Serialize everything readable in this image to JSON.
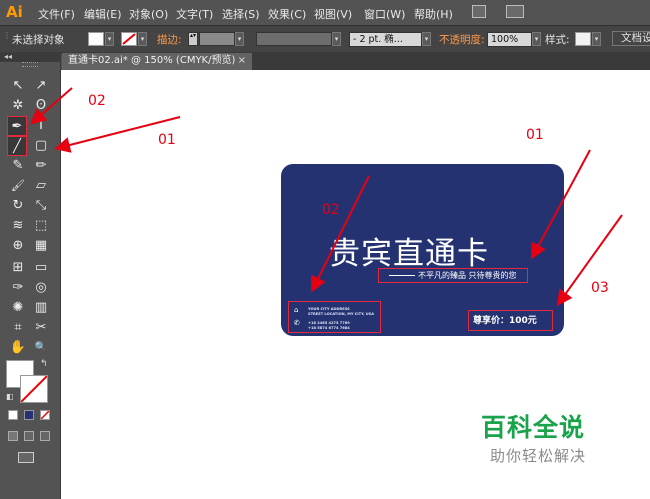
{
  "app": {
    "logo": "Ai"
  },
  "menu": [
    "文件(F)",
    "编辑(E)",
    "对象(O)",
    "文字(T)",
    "选择(S)",
    "效果(C)",
    "视图(V)",
    "窗口(W)",
    "帮助(H)"
  ],
  "control_bar": {
    "selection_status": "未选择对象",
    "stroke_label": "描边:",
    "stroke_profile": "- 2 pt. 椭...",
    "opacity_label": "不透明度:",
    "opacity_value": "100%",
    "style_label": "样式:",
    "doc_setup": "文档设"
  },
  "document_tab": {
    "title": "直通卡02.ai* @ 150% (CMYK/预览)",
    "close": "×"
  },
  "toolbox": {
    "header": "◂◂",
    "tools": [
      {
        "name": "selection-tool",
        "glyph": "↖"
      },
      {
        "name": "direct-selection-tool",
        "glyph": "↗"
      },
      {
        "name": "magic-wand-tool",
        "glyph": "✲"
      },
      {
        "name": "lasso-tool",
        "glyph": "ʘ"
      },
      {
        "name": "pen-tool",
        "glyph": "✒"
      },
      {
        "name": "type-tool",
        "glyph": "T"
      },
      {
        "name": "line-segment-tool",
        "glyph": "╱"
      },
      {
        "name": "rounded-rectangle-tool",
        "glyph": "▢"
      },
      {
        "name": "paintbrush-tool",
        "glyph": "✎"
      },
      {
        "name": "pencil-tool",
        "glyph": "✏"
      },
      {
        "name": "blob-brush-tool",
        "glyph": "🖌"
      },
      {
        "name": "eraser-tool",
        "glyph": "▱"
      },
      {
        "name": "rotate-tool",
        "glyph": "↻"
      },
      {
        "name": "scale-tool",
        "glyph": "⤡"
      },
      {
        "name": "width-tool",
        "glyph": "≋"
      },
      {
        "name": "free-transform-tool",
        "glyph": "⬚"
      },
      {
        "name": "shape-builder-tool",
        "glyph": "⊕"
      },
      {
        "name": "perspective-grid-tool",
        "glyph": "▦"
      },
      {
        "name": "mesh-tool",
        "glyph": "⊞"
      },
      {
        "name": "gradient-tool",
        "glyph": "▭"
      },
      {
        "name": "eyedropper-tool",
        "glyph": "✑"
      },
      {
        "name": "blend-tool",
        "glyph": "◎"
      },
      {
        "name": "symbol-sprayer-tool",
        "glyph": "✺"
      },
      {
        "name": "column-graph-tool",
        "glyph": "▥"
      },
      {
        "name": "artboard-tool",
        "glyph": "⌗"
      },
      {
        "name": "slice-tool",
        "glyph": "✂"
      },
      {
        "name": "hand-tool",
        "glyph": "✋"
      },
      {
        "name": "zoom-tool",
        "glyph": "🔍"
      }
    ]
  },
  "card": {
    "title": "贵宾直通卡",
    "slogan": "不平凡的臻品 只待尊贵的您",
    "contact": [
      "YOUR CITY ADDRESS",
      "STREET LOCATION, MY CITY, USA",
      "+18 2465 4275 7769",
      "+18 5874 6774 7684"
    ],
    "price": "尊享价：100元"
  },
  "annotations": {
    "left_02": "02",
    "left_01": "01",
    "card_01": "01",
    "card_02": "02",
    "card_03": "03"
  },
  "watermark": {
    "main": "百科全说",
    "sub": "助你轻松解决"
  },
  "colors": {
    "card_bg": "#253271",
    "annotation": "#e60012",
    "watermark": "#1aa34a"
  }
}
